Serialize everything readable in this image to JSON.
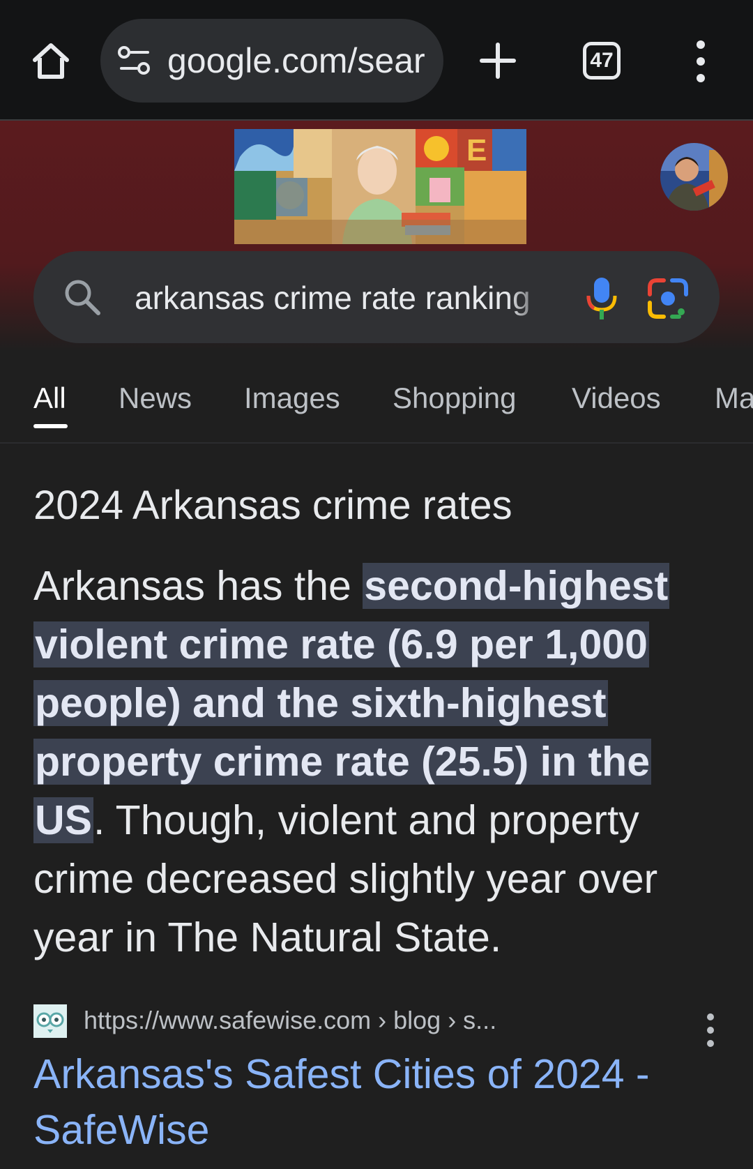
{
  "browser": {
    "url": "google.com/search",
    "tab_count": "47"
  },
  "search": {
    "query": "arkansas crime rate ranking"
  },
  "categories": [
    "All",
    "News",
    "Images",
    "Shopping",
    "Videos",
    "Maps"
  ],
  "snippet": {
    "title": "2024 Arkansas crime rates",
    "text_before": "Arkansas has the ",
    "highlight": "second-highest violent crime rate (6.9 per 1,000 people) and the sixth-highest property crime rate (25.5) in the US",
    "text_after": ". Though, violent and property crime decreased slightly year over year in The Natural State."
  },
  "result": {
    "source_url": "https://www.safewise.com › blog › s...",
    "title": "Arkansas's Safest Cities of 2024 - SafeWise"
  },
  "colors": {
    "header_bg": "#5b1b1e",
    "link": "#8ab4f8",
    "highlight_bg": "#3c4251"
  }
}
